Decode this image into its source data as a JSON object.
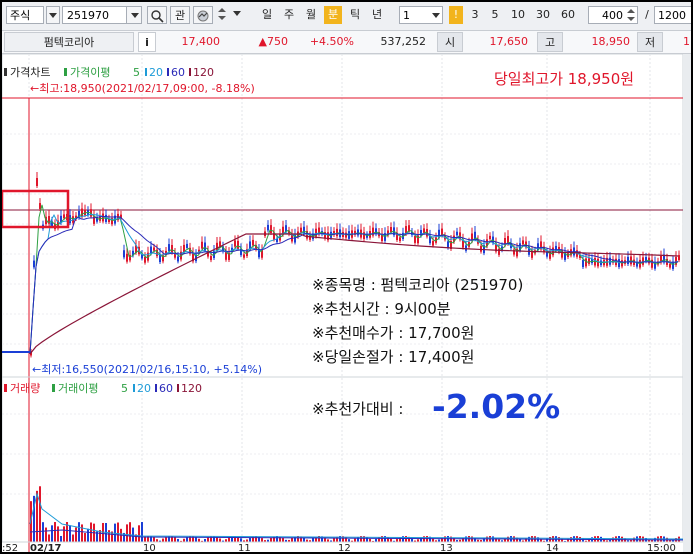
{
  "toolbar": {
    "market_label": "주식",
    "stock_code": "251970",
    "interest_label": "관",
    "period_buttons": [
      "일",
      "주",
      "월",
      "분",
      "틱",
      "년"
    ],
    "interval_value": "1",
    "tick_buttons": [
      "!",
      "3",
      "5",
      "10",
      "30",
      "60"
    ],
    "count_value": "400",
    "slash": "/",
    "total_value": "1200"
  },
  "quote": {
    "name": "펌텍코리아",
    "info_icon": "i",
    "price": "17,400",
    "change": "▲750",
    "change_pct": "+4.50%",
    "volume": "537,252",
    "open_label": "시",
    "open": "17,650",
    "high_label": "고",
    "high": "18,950",
    "low_label": "저",
    "low": "1"
  },
  "price_panel": {
    "title": "가격차트",
    "ma_label": "가격이평",
    "ma_periods": [
      "5",
      "20",
      "60",
      "120"
    ],
    "high_note": "←최고:18,950(2021/02/17,09:00, -8.18%)",
    "low_note": "←최저:16,550(2021/02/16,15:10, +5.14%)",
    "day_high_banner": "당일최고가 18,950원",
    "info": [
      "※종목명 : 펌텍코리아 (251970)",
      "※추천시간 : 9시00분",
      "※추천매수가 : 17,700원",
      "※당일손절가 : 17,400원"
    ]
  },
  "volume_panel": {
    "title": "거래량",
    "ma_label": "거래이평",
    "ma_periods": [
      "5",
      "20",
      "60",
      "120"
    ],
    "result_label": "※추천가대비 :",
    "result_value": "-2.02%"
  },
  "x_axis": {
    "labels": [
      ":52",
      "02/17",
      "10",
      "11",
      "12",
      "13",
      "14",
      "15:00"
    ]
  },
  "colors": {
    "up": "#e0162b",
    "down": "#1a3fd6",
    "ma5": "#2ea043",
    "ma20": "#1e9bd7",
    "ma60": "#2a2ab8",
    "ma120": "#8a1538",
    "accent": "#f2b41d"
  }
}
